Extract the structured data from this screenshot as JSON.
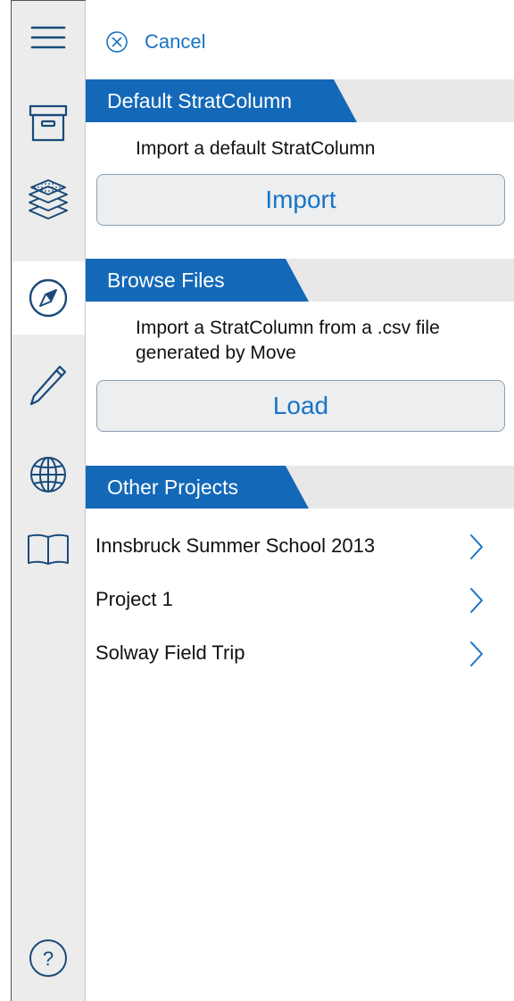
{
  "sidebar": {
    "items": [
      {
        "icon": "menu-icon"
      },
      {
        "icon": "archive-box-icon"
      },
      {
        "icon": "layers-icon"
      },
      {
        "icon": "compass-icon",
        "active": true
      },
      {
        "icon": "pencil-icon"
      },
      {
        "icon": "globe-icon"
      },
      {
        "icon": "book-icon"
      },
      {
        "icon": "help-icon",
        "glyph": "?"
      }
    ]
  },
  "cancel": {
    "label": "Cancel",
    "icon": "cancel-circle-icon"
  },
  "sections": {
    "default": {
      "title": "Default StratColumn",
      "description": "Import a default StratColumn",
      "button": "Import"
    },
    "browse": {
      "title": "Browse Files",
      "description_line1": "Import a StratColumn from a .csv file",
      "description_line2": "generated by Move",
      "button": "Load"
    },
    "other": {
      "title": "Other Projects",
      "projects": [
        {
          "name": "Innsbruck Summer School 2013",
          "icon": "chevron-right-icon"
        },
        {
          "name": "Project 1",
          "icon": "chevron-right-icon"
        },
        {
          "name": "Solway Field Trip",
          "icon": "chevron-right-icon"
        }
      ]
    }
  },
  "colors": {
    "accent": "#1873c6",
    "header_tab": "#1468b8",
    "header_bar": "#e8e8e8",
    "sidebar_bg": "#ececec",
    "icon_color": "#1a4a7a"
  }
}
